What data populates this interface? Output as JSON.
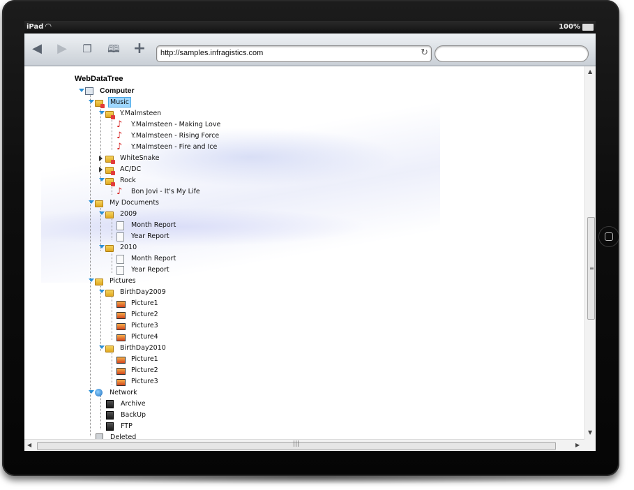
{
  "status_bar": {
    "carrier": "iPad",
    "battery": "100%"
  },
  "browser": {
    "url": "http://samples.infragistics.com",
    "search_placeholder": "",
    "icons": [
      "back-icon",
      "forward-icon",
      "tabs-icon",
      "bookmarks-icon",
      "add-icon",
      "reload-icon"
    ]
  },
  "tree": {
    "title": "WebDataTree",
    "root": "Computer",
    "music": {
      "label": "Music",
      "ymalmsteen": "Y.Malmsteen",
      "songs": [
        "Y.Malmsteen - Making Love",
        "Y.Malmsteen - Rising Force",
        "Y.Malmsteen - Fire and Ice"
      ],
      "whitesnake": "WhiteSnake",
      "acdc": "AC/DC",
      "rock": "Rock",
      "rock_song": "Bon Jovi - It's My Life"
    },
    "documents": {
      "label": "My Documents",
      "y2009": "2009",
      "y2009_items": [
        "Month Report",
        "Year Report"
      ],
      "y2010": "2010",
      "y2010_items": [
        "Month Report",
        "Year Report"
      ]
    },
    "pictures": {
      "label": "Pictures",
      "bd2009": "BirthDay2009",
      "bd2009_items": [
        "Picture1",
        "Picture2",
        "Picture3",
        "Picture4"
      ],
      "bd2010": "BirthDay2010",
      "bd2010_items": [
        "Picture1",
        "Picture2",
        "Picture3"
      ]
    },
    "network": {
      "label": "Network",
      "items": [
        "Archive",
        "BackUp",
        "FTP"
      ]
    },
    "deleted": "Deleted"
  }
}
